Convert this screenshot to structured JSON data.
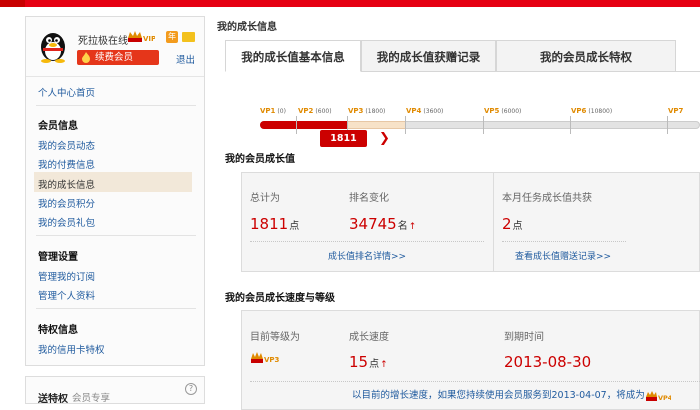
{
  "colors": {
    "brand_red": "#cc0000",
    "link_blue": "#1f5a9e",
    "vip_orange": "#e08a00"
  },
  "user": {
    "name": "死拉极在线",
    "vip_badge": "VIP3",
    "renew_label": "续费会员",
    "logout_label": "退出",
    "icons": [
      "qq-penguin-avatar-icon",
      "vip-crown-icon",
      "annual-nian-icon",
      "folder-icon",
      "flame-icon"
    ]
  },
  "sidebar": {
    "home_link": "个人中心首页",
    "groups": [
      {
        "title": "会员信息",
        "items": [
          "我的会员动态",
          "我的付费信息",
          "我的成长信息",
          "我的会员积分",
          "我的会员礼包"
        ]
      },
      {
        "title": "管理设置",
        "items": [
          "管理我的订阅",
          "管理个人资料"
        ]
      },
      {
        "title": "特权信息",
        "items": [
          "我的信用卡特权"
        ]
      }
    ],
    "active_item": "我的成长信息"
  },
  "promo": {
    "title": "送特权",
    "subtitle": "会员专享",
    "help": "?"
  },
  "page_title": "我的成长信息",
  "tabs": [
    "我的成长值基本信息",
    "我的成长值获赠记录",
    "我的会员成长特权"
  ],
  "progress": {
    "current_score": "1811",
    "levels": [
      {
        "name": "VP1",
        "threshold": "(0)"
      },
      {
        "name": "VP2",
        "threshold": "(600)"
      },
      {
        "name": "VP3",
        "threshold": "(1800)"
      },
      {
        "name": "VP4",
        "threshold": "(3600)"
      },
      {
        "name": "VP5",
        "threshold": "(6000)"
      },
      {
        "name": "VP6",
        "threshold": "(10800)"
      },
      {
        "name": "VP7",
        "threshold": ""
      }
    ],
    "fill_fraction": 0.2
  },
  "growth": {
    "section_title": "我的会员成长值",
    "total_label": "总计为",
    "total_value": "1811",
    "total_unit": "点",
    "rank_label": "排名变化",
    "rank_value": "34745",
    "rank_unit": "名",
    "task_label": "本月任务成长值共获",
    "task_value": "2",
    "task_unit": "点",
    "rank_detail_link": "成长值排名详情>>",
    "gift_record_link": "查看成长值赠送记录>>"
  },
  "speed": {
    "section_title": "我的会员成长速度与等级",
    "level_label": "目前等级为",
    "level_value": "VP3",
    "speed_label": "成长速度",
    "speed_value": "15",
    "speed_unit": "点",
    "expire_label": "到期时间",
    "expire_value": "2013-08-30",
    "note": "以目前的增长速度，如果您持续使用会员服务到2013-04-07，将成为",
    "note_level": "VP4"
  },
  "arrow_glyph": "❯",
  "up_arrow_glyph": "↑"
}
